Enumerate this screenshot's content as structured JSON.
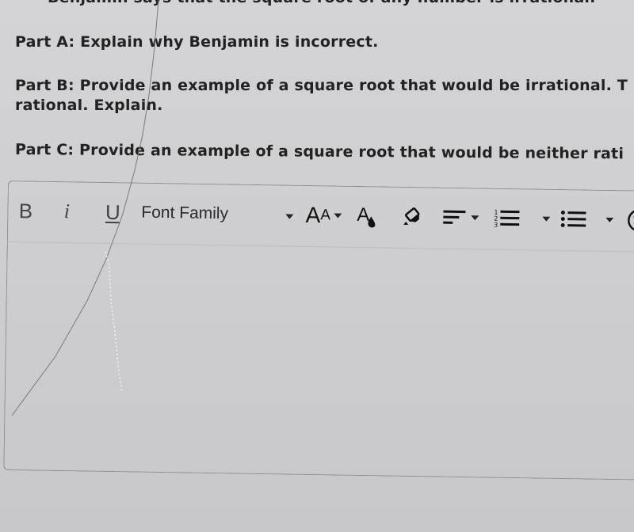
{
  "question": {
    "intro_partial": "Benjamin says that the square root of any number is irrational.",
    "part_a": "Part A: Explain why Benjamin is incorrect.",
    "part_b_line1": "Part B: Provide an example of a square root that would be irrational. T",
    "part_b_line2": "rational. Explain.",
    "part_c": "Part C: Provide an example of a square root that would be neither rati"
  },
  "editor": {
    "toolbar": {
      "bold_label": "B",
      "italic_label": "i",
      "underline_label": "U",
      "font_family_label": "Font Family",
      "font_size_big": "A",
      "font_size_small": "A"
    },
    "body_text": ""
  },
  "icons": {
    "bold": "bold-icon",
    "italic": "italic-icon",
    "underline": "underline-icon",
    "font_family": "font-family-dropdown",
    "font_size": "font-size-icon",
    "text_color": "text-color-icon",
    "highlight": "highlighter-icon",
    "align": "align-left-icon",
    "ordered_list": "numbered-list-icon",
    "unordered_list": "bulleted-list-icon",
    "emoji": "emoji-icon"
  }
}
